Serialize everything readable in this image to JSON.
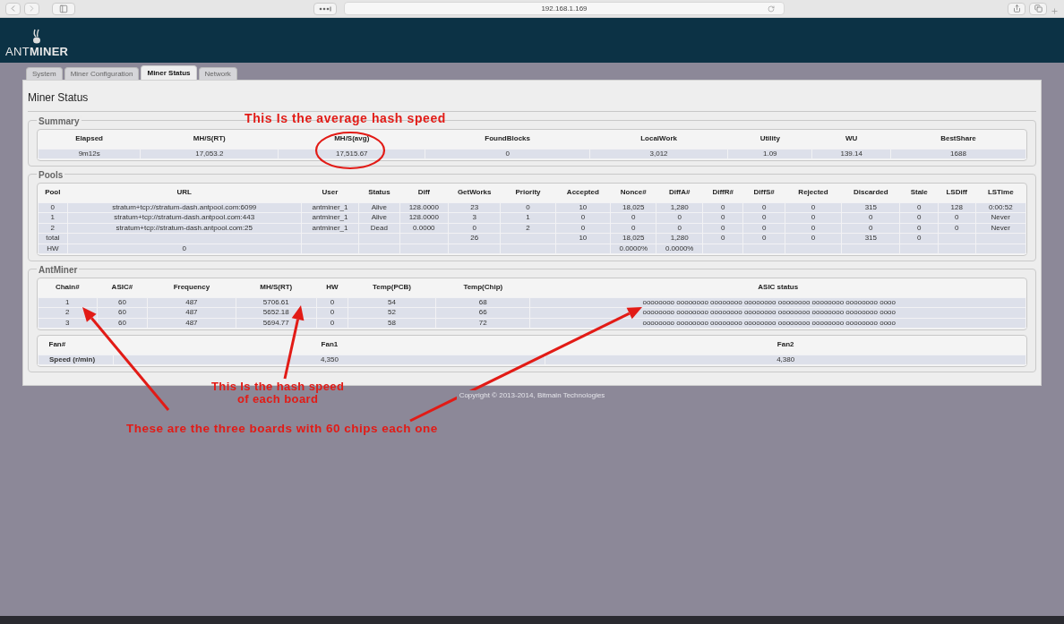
{
  "browser": {
    "url": "192.168.1.169"
  },
  "logo": {
    "first": "ANT",
    "second": "MINER"
  },
  "tabs": [
    {
      "label": "System",
      "selected": false
    },
    {
      "label": "Miner Configuration",
      "selected": false
    },
    {
      "label": "Miner Status",
      "selected": true
    },
    {
      "label": "Network",
      "selected": false
    }
  ],
  "page_title": "Miner Status",
  "summary": {
    "title": "Summary",
    "columns": [
      "Elapsed",
      "MH/S(RT)",
      "MH/S(avg)",
      "FoundBlocks",
      "LocalWork",
      "Utility",
      "WU",
      "BestShare"
    ],
    "rows": [
      [
        "9m12s",
        "17,053.2",
        "17,515.67",
        "0",
        "3,012",
        "1.09",
        "139.14",
        "1688"
      ]
    ]
  },
  "pools": {
    "title": "Pools",
    "columns": [
      "Pool",
      "URL",
      "User",
      "Status",
      "Diff",
      "GetWorks",
      "Priority",
      "Accepted",
      "Nonce#",
      "DiffA#",
      "DiffR#",
      "DiffS#",
      "Rejected",
      "Discarded",
      "Stale",
      "LSDiff",
      "LSTime"
    ],
    "rows": [
      [
        "0",
        "stratum+tcp://stratum-dash.antpool.com:6099",
        "antminer_1",
        "Alive",
        "128.0000",
        "23",
        "0",
        "10",
        "18,025",
        "1,280",
        "0",
        "0",
        "0",
        "315",
        "0",
        "128",
        "0:00:52"
      ],
      [
        "1",
        "stratum+tcp://stratum-dash.antpool.com:443",
        "antminer_1",
        "Alive",
        "128.0000",
        "3",
        "1",
        "0",
        "0",
        "0",
        "0",
        "0",
        "0",
        "0",
        "0",
        "0",
        "Never"
      ],
      [
        "2",
        "stratum+tcp://stratum-dash.antpool.com:25",
        "antminer_1",
        "Dead",
        "0.0000",
        "0",
        "2",
        "0",
        "0",
        "0",
        "0",
        "0",
        "0",
        "0",
        "0",
        "0",
        "Never"
      ],
      [
        "total",
        null,
        null,
        null,
        null,
        "26",
        null,
        "10",
        "18,025",
        "1,280",
        "0",
        "0",
        "0",
        "315",
        "0",
        null,
        null
      ],
      [
        "HW",
        "0",
        null,
        null,
        null,
        null,
        null,
        null,
        "0.0000%",
        "0.0000%",
        null,
        null,
        null,
        null,
        null,
        null,
        null
      ]
    ]
  },
  "antminer": {
    "title": "AntMiner",
    "chains": {
      "columns": [
        "Chain#",
        "ASIC#",
        "Frequency",
        "MH/S(RT)",
        "HW",
        "Temp(PCB)",
        "Temp(Chip)",
        "ASIC status"
      ],
      "rows": [
        [
          "1",
          "60",
          "487",
          "5706.61",
          "0",
          "54",
          "68",
          "oooooooo oooooooo oooooooo oooooooo oooooooo oooooooo oooooooo oooo"
        ],
        [
          "2",
          "60",
          "487",
          "5652.18",
          "0",
          "52",
          "66",
          "oooooooo oooooooo oooooooo oooooooo oooooooo oooooooo oooooooo oooo"
        ],
        [
          "3",
          "60",
          "487",
          "5694.77",
          "0",
          "58",
          "72",
          "oooooooo oooooooo oooooooo oooooooo oooooooo oooooooo oooooooo oooo"
        ]
      ]
    },
    "fans": {
      "columns": [
        "Fan#",
        "Fan1",
        "Fan2"
      ],
      "rows": [
        [
          "Speed (r/min)",
          "4,350",
          "4,380"
        ]
      ]
    }
  },
  "footer": "Copyright © 2013-2014, Bitmain Technologies",
  "notes": {
    "average": "This Is the average hash speed",
    "board_speed": [
      "This Is the hash speed",
      "of each board"
    ],
    "boards": "These are the three boards with 60 chips each one"
  }
}
